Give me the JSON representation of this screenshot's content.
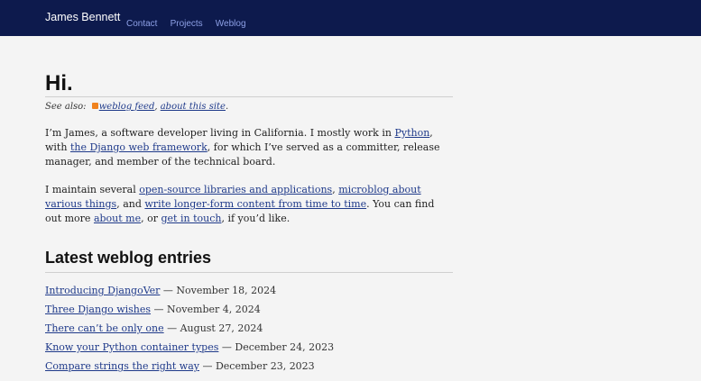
{
  "header": {
    "brand": "James Bennett",
    "nav": [
      "Contact",
      "Projects",
      "Weblog"
    ]
  },
  "page": {
    "title": "Hi.",
    "see_also_label": "See also:",
    "weblog_feed": "weblog feed",
    "about_site": "about this site",
    "intro": {
      "t1": "I’m James, a software developer living in California. I mostly work in ",
      "python": "Python",
      "t2": ", with ",
      "django": "the Django web framework",
      "t3": ", for which I’ve served as a committer, release manager, and member of the technical board."
    },
    "maintain": {
      "t1": "I maintain several ",
      "oss": "open-source libraries and applications",
      "t2": ", ",
      "microblog": "microblog about various things",
      "t3": ", and ",
      "longform": "write longer-form content from time to time",
      "t4": ". You can find out more ",
      "about_me": "about me",
      "t5": ", or ",
      "touch": "get in touch",
      "t6": ", if you’d like."
    }
  },
  "latest": {
    "heading": "Latest weblog entries",
    "entries": [
      {
        "title": "Introducing DjangoVer",
        "date": " — November 18, 2024"
      },
      {
        "title": "Three Django wishes",
        "date": " — November 4, 2024"
      },
      {
        "title": "There can’t be only one",
        "date": " — August 27, 2024"
      },
      {
        "title": "Know your Python container types",
        "date": " — December 24, 2023"
      },
      {
        "title": "Compare strings the right way",
        "date": " — December 23, 2023"
      }
    ]
  },
  "colors": {
    "header_bg": "#0d1a4d",
    "link": "#1f3a8a",
    "nav_link": "#8da0e6",
    "background": "#f4f4f4"
  }
}
